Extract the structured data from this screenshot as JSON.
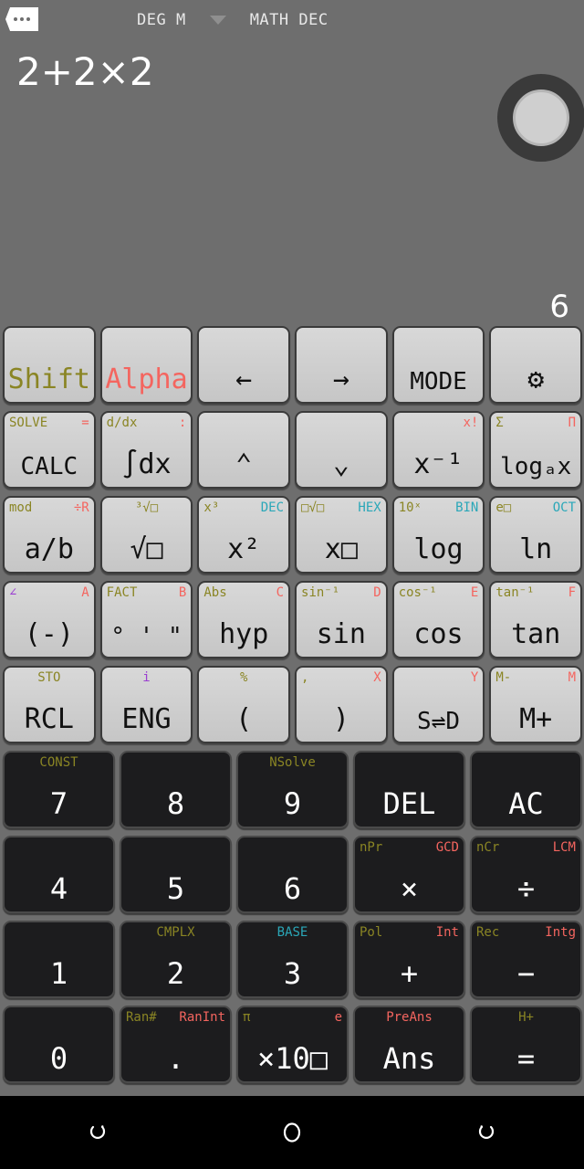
{
  "statusbar": {
    "badge_icon": "more-dots-tag-icon",
    "mode_angle": "DEG  M",
    "dropdown_icon": "chevron-down-icon",
    "mode_display": "MATH DEC"
  },
  "display": {
    "expression": "2+2×2",
    "result": "6",
    "dial_icon": "rotary-dial-icon"
  },
  "keypad": {
    "rows": [
      {
        "type": "function",
        "keys": [
          {
            "name": "shift-key",
            "main": "Shift",
            "main_color": "#8a8524"
          },
          {
            "name": "alpha-key",
            "main": "Alpha",
            "main_color": "#f4655f"
          },
          {
            "name": "left-arrow-key",
            "main": "←"
          },
          {
            "name": "right-arrow-key",
            "main": "→"
          },
          {
            "name": "mode-key",
            "main": "MODE",
            "small": true
          },
          {
            "name": "settings-key",
            "main": "⚙",
            "icon": "gear-icon"
          }
        ]
      },
      {
        "type": "function",
        "keys": [
          {
            "name": "calc-key",
            "main": "CALC",
            "small": true,
            "sub_left": "SOLVE",
            "sub_right": "="
          },
          {
            "name": "integral-key",
            "main": "∫dx",
            "sub_left": "d/dx",
            "sub_right": ":"
          },
          {
            "name": "up-arrow-key",
            "main": "⌃"
          },
          {
            "name": "down-arrow-key",
            "main": "⌄"
          },
          {
            "name": "inverse-key",
            "main": "x⁻¹",
            "sub_right": "x!"
          },
          {
            "name": "log-base-key",
            "main": "logₐx",
            "small": true,
            "sub_left": "Σ",
            "sub_right": "Π"
          }
        ]
      },
      {
        "type": "function",
        "keys": [
          {
            "name": "fraction-key",
            "main": "a/b",
            "sub_left": "mod",
            "sub_right": "÷R"
          },
          {
            "name": "sqrt-key",
            "main": "√□",
            "sub_center": "³√□"
          },
          {
            "name": "square-key",
            "main": "x²",
            "sub_left": "x³",
            "sub_right": "DEC",
            "sub_right_color": "teal"
          },
          {
            "name": "power-key",
            "main": "x□",
            "sub_left": "□√□",
            "sub_right": "HEX",
            "sub_right_color": "teal"
          },
          {
            "name": "log-key",
            "main": "log",
            "sub_left": "10ˣ",
            "sub_right": "BIN",
            "sub_right_color": "teal"
          },
          {
            "name": "ln-key",
            "main": "ln",
            "sub_left": "e□",
            "sub_right": "OCT",
            "sub_right_color": "teal"
          }
        ]
      },
      {
        "type": "function",
        "keys": [
          {
            "name": "negative-key",
            "main": "(-)",
            "sub_left": "∠",
            "sub_left_color": "purple",
            "sub_right": "A"
          },
          {
            "name": "dms-key",
            "main": "° ' \"",
            "small": true,
            "sub_left": "FACT",
            "sub_right": "B"
          },
          {
            "name": "hyp-key",
            "main": "hyp",
            "sub_left": "Abs",
            "sub_right": "C"
          },
          {
            "name": "sin-key",
            "main": "sin",
            "sub_left": "sin⁻¹",
            "sub_right": "D"
          },
          {
            "name": "cos-key",
            "main": "cos",
            "sub_left": "cos⁻¹",
            "sub_right": "E"
          },
          {
            "name": "tan-key",
            "main": "tan",
            "sub_left": "tan⁻¹",
            "sub_right": "F"
          }
        ]
      },
      {
        "type": "function",
        "keys": [
          {
            "name": "recall-key",
            "main": "RCL",
            "sub_center": "STO"
          },
          {
            "name": "eng-key",
            "main": "ENG",
            "sub_center": "i",
            "sub_center_color": "purple"
          },
          {
            "name": "open-paren-key",
            "main": "(",
            "sub_center": "%"
          },
          {
            "name": "close-paren-key",
            "main": ")",
            "sub_left": ",",
            "sub_right": "X"
          },
          {
            "name": "std-dec-toggle-key",
            "main": "S⇌D",
            "small": true,
            "sub_right": "Y"
          },
          {
            "name": "memory-plus-key",
            "main": "M+",
            "sub_left": "M-",
            "sub_right": "M"
          }
        ]
      },
      {
        "type": "number",
        "keys": [
          {
            "name": "digit-7-key",
            "main": "7",
            "sub_center": "CONST"
          },
          {
            "name": "digit-8-key",
            "main": "8"
          },
          {
            "name": "digit-9-key",
            "main": "9",
            "sub_center": "NSolve"
          },
          {
            "name": "delete-key",
            "main": "DEL",
            "gray": true,
            "small": true
          },
          {
            "name": "all-clear-key",
            "main": "AC",
            "gray": true,
            "small": true
          }
        ]
      },
      {
        "type": "number",
        "keys": [
          {
            "name": "digit-4-key",
            "main": "4"
          },
          {
            "name": "digit-5-key",
            "main": "5"
          },
          {
            "name": "digit-6-key",
            "main": "6"
          },
          {
            "name": "multiply-key",
            "main": "×",
            "sub_left": "nPr",
            "sub_right": "GCD"
          },
          {
            "name": "divide-key",
            "main": "÷",
            "sub_left": "nCr",
            "sub_right": "LCM"
          }
        ]
      },
      {
        "type": "number",
        "keys": [
          {
            "name": "digit-1-key",
            "main": "1"
          },
          {
            "name": "digit-2-key",
            "main": "2",
            "sub_center": "CMPLX"
          },
          {
            "name": "digit-3-key",
            "main": "3",
            "sub_center": "BASE",
            "sub_center_color": "teal"
          },
          {
            "name": "plus-key",
            "main": "+",
            "sub_left": "Pol",
            "sub_right": "Int"
          },
          {
            "name": "minus-key",
            "main": "−",
            "sub_left": "Rec",
            "sub_right": "Intg"
          }
        ]
      },
      {
        "type": "number",
        "keys": [
          {
            "name": "digit-0-key",
            "main": "0"
          },
          {
            "name": "decimal-point-key",
            "main": ".",
            "sub_left": "Ran#",
            "sub_right": "RanInt"
          },
          {
            "name": "exponent-key",
            "main": "×10□",
            "small": true,
            "sub_left": "π",
            "sub_right": "e"
          },
          {
            "name": "answer-key",
            "main": "Ans",
            "sub_center": "PreAns",
            "sub_center_color": "alpha"
          },
          {
            "name": "equals-key",
            "main": "=",
            "sub_center": "H+"
          }
        ]
      }
    ]
  },
  "navbar": {
    "back_icon": "back-nav-icon",
    "home_icon": "home-nav-icon",
    "recents_icon": "recents-nav-icon"
  }
}
